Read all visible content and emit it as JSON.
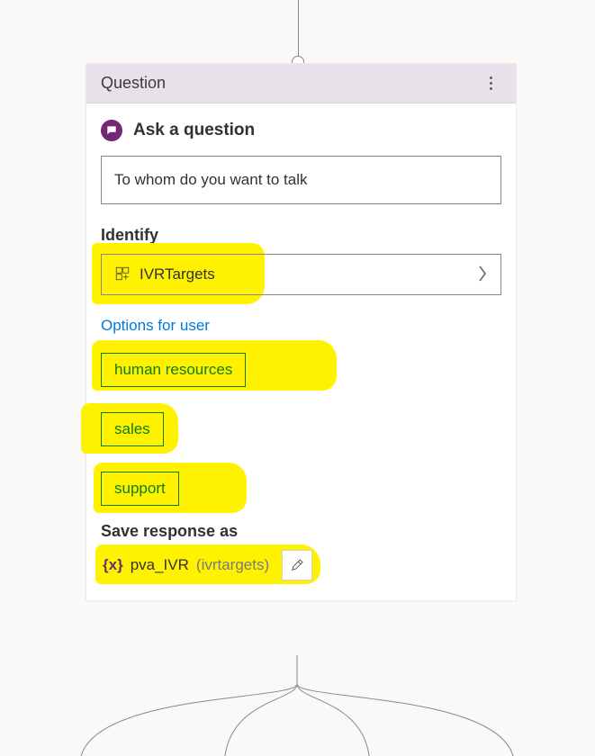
{
  "node": {
    "type_label": "Question",
    "ask_label": "Ask a question",
    "question_value": "To whom do you want to talk",
    "identify": {
      "label": "Identify",
      "entity_name": "IVRTargets"
    },
    "options": {
      "link_label": "Options for user",
      "items": [
        "human resources",
        "sales",
        "support"
      ]
    },
    "save_response": {
      "label": "Save response as",
      "variable_name": "pva_IVR",
      "variable_type": "ivrtargets"
    }
  }
}
